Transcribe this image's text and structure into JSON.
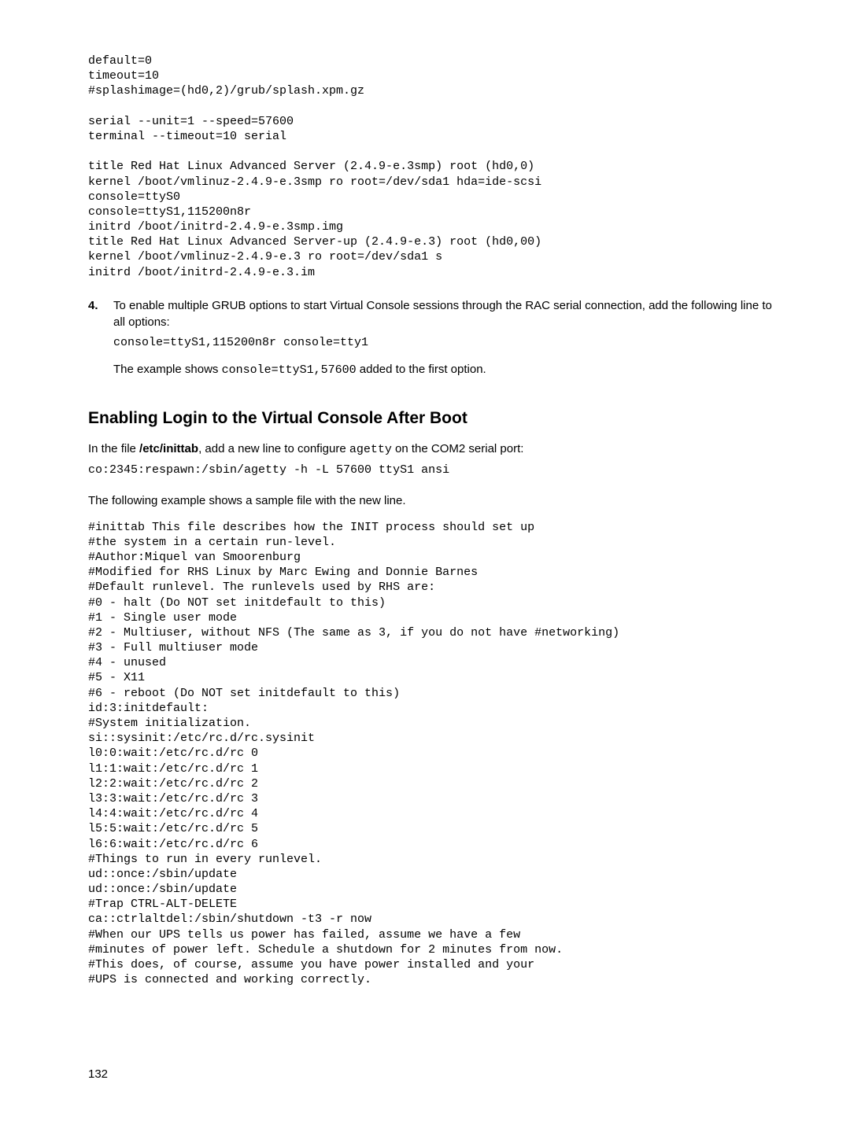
{
  "code_block_1": "default=0\ntimeout=10\n#splashimage=(hd0,2)/grub/splash.xpm.gz\n\nserial --unit=1 --speed=57600\nterminal --timeout=10 serial\n\ntitle Red Hat Linux Advanced Server (2.4.9-e.3smp) root (hd0,0)\nkernel /boot/vmlinuz-2.4.9-e.3smp ro root=/dev/sda1 hda=ide-scsi\nconsole=ttyS0\nconsole=ttyS1,115200n8r\ninitrd /boot/initrd-2.4.9-e.3smp.img\ntitle Red Hat Linux Advanced Server-up (2.4.9-e.3) root (hd0,00)\nkernel /boot/vmlinuz-2.4.9-e.3 ro root=/dev/sda1 s\ninitrd /boot/initrd-2.4.9-e.3.im",
  "step4": {
    "num": "4.",
    "para": "To enable multiple GRUB options to start Virtual Console sessions through the RAC serial connection, add the following line to all options:",
    "code": "console=ttyS1,115200n8r console=tty1",
    "para2_prefix": "The example shows ",
    "para2_code": "console=ttyS1,57600",
    "para2_suffix": " added to the first option."
  },
  "section_heading": "Enabling Login to the Virtual Console After Boot",
  "intro": {
    "prefix": "In the file ",
    "bold": "/etc/inittab",
    "mid": ", add a new line to configure ",
    "code": "agetty",
    "suffix": " on the COM2 serial port:"
  },
  "code_intro": "co:2345:respawn:/sbin/agetty -h -L 57600 ttyS1 ansi",
  "example_lead": "The following example shows a sample file with the new line.",
  "code_block_2": "#inittab This file describes how the INIT process should set up\n#the system in a certain run-level.\n#Author:Miquel van Smoorenburg\n#Modified for RHS Linux by Marc Ewing and Donnie Barnes\n#Default runlevel. The runlevels used by RHS are:\n#0 - halt (Do NOT set initdefault to this)\n#1 - Single user mode\n#2 - Multiuser, without NFS (The same as 3, if you do not have #networking)\n#3 - Full multiuser mode\n#4 - unused\n#5 - X11\n#6 - reboot (Do NOT set initdefault to this)\nid:3:initdefault:\n#System initialization.\nsi::sysinit:/etc/rc.d/rc.sysinit\nl0:0:wait:/etc/rc.d/rc 0\nl1:1:wait:/etc/rc.d/rc 1\nl2:2:wait:/etc/rc.d/rc 2\nl3:3:wait:/etc/rc.d/rc 3\nl4:4:wait:/etc/rc.d/rc 4\nl5:5:wait:/etc/rc.d/rc 5\nl6:6:wait:/etc/rc.d/rc 6\n#Things to run in every runlevel.\nud::once:/sbin/update\nud::once:/sbin/update\n#Trap CTRL-ALT-DELETE\nca::ctrlaltdel:/sbin/shutdown -t3 -r now\n#When our UPS tells us power has failed, assume we have a few\n#minutes of power left. Schedule a shutdown for 2 minutes from now.\n#This does, of course, assume you have power installed and your\n#UPS is connected and working correctly.",
  "page_number": "132"
}
